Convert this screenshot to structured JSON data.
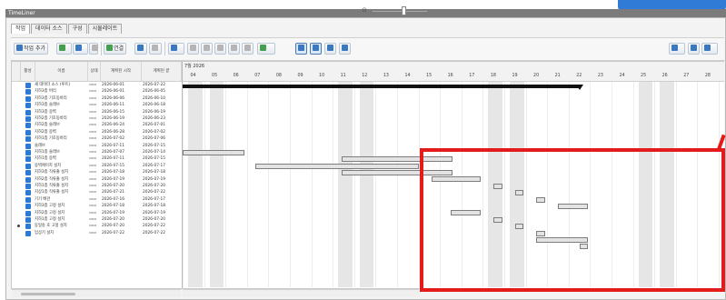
{
  "window": {
    "title": "TimeLiner"
  },
  "tabs": [
    "작업",
    "데이터 소스",
    "구성",
    "시뮬레이트"
  ],
  "toolbar": {
    "add_task": "작업 추가",
    "attach": "연결"
  },
  "columns": [
    "활성",
    "이름",
    "상태",
    "계획된 시작",
    "계획된 끝"
  ],
  "tasks": [
    {
      "name": "새 데이터 소스 (루트)",
      "status": "▭▭",
      "start": "2026-06-01",
      "end": "2026-07-22"
    },
    {
      "name": "지하3층 버리",
      "status": "▭▭",
      "start": "2026-06-01",
      "end": "2026-06-05"
    },
    {
      "name": "지하3층 기초동바리",
      "status": "▭▭",
      "start": "2026-06-06",
      "end": "2026-06-10"
    },
    {
      "name": "지하3층 슬래브",
      "status": "▭▭",
      "start": "2026-06-11",
      "end": "2026-06-18"
    },
    {
      "name": "지하3층 옹벽",
      "status": "▭▭",
      "start": "2026-06-15",
      "end": "2026-06-19"
    },
    {
      "name": "지하2층 기초동바리",
      "status": "▭▭",
      "start": "2026-06-19",
      "end": "2026-06-23"
    },
    {
      "name": "지하2층 슬래브",
      "status": "▭▭",
      "start": "2026-06-24",
      "end": "2026-07-01"
    },
    {
      "name": "지하2층 옹벽",
      "status": "▭▭",
      "start": "2026-06-28",
      "end": "2026-07-02"
    },
    {
      "name": "지하1층 기초동바리",
      "status": "▭▭",
      "start": "2026-07-02",
      "end": "2026-07-06"
    },
    {
      "name": "슬래브",
      "status": "▭▭",
      "start": "2026-07-11",
      "end": "2026-07-15"
    },
    {
      "name": "지하1층 슬래브",
      "status": "▭▭",
      "start": "2026-07-07",
      "end": "2026-07-14"
    },
    {
      "name": "지하1층 옹벽",
      "status": "▭▭",
      "start": "2026-07-11",
      "end": "2026-07-15"
    },
    {
      "name": "옹벽에이치 설치",
      "status": "▭▭",
      "start": "2026-07-15",
      "end": "2026-07-17"
    },
    {
      "name": "지하3층 직류출 설치",
      "status": "▭▭",
      "start": "2026-07-18",
      "end": "2026-07-18"
    },
    {
      "name": "지하2층 직류출 설치",
      "status": "▭▭",
      "start": "2026-07-19",
      "end": "2026-07-19"
    },
    {
      "name": "지하1층 직류출 설치",
      "status": "▭▭",
      "start": "2026-07-20",
      "end": "2026-07-20"
    },
    {
      "name": "지상1층 직류출 설치",
      "status": "▭▭",
      "start": "2026-07-21",
      "end": "2026-07-22"
    },
    {
      "name": "기기 배관",
      "status": "▭▭",
      "start": "2026-07-16",
      "end": "2026-07-17"
    },
    {
      "name": "지하3층 고정 설치",
      "status": "▭▭",
      "start": "2026-07-18",
      "end": "2026-07-18"
    },
    {
      "name": "지하2층 고정 설치",
      "status": "▭▭",
      "start": "2026-07-19",
      "end": "2026-07-19"
    },
    {
      "name": "지하1층 고정 설치",
      "status": "▭▭",
      "start": "2026-07-20",
      "end": "2026-07-20"
    },
    {
      "name": "동일송 호 고정 설치",
      "status": "▭▭",
      "start": "2026-07-20",
      "end": "2026-07-22"
    },
    {
      "name": "입상기 설치",
      "status": "▭▭",
      "start": "2026-07-22",
      "end": "2026-07-22"
    }
  ],
  "timeline": {
    "month_label": "7월 2026",
    "days": [
      "04",
      "05",
      "06",
      "07",
      "08",
      "09",
      "10",
      "11",
      "12",
      "13",
      "14",
      "15",
      "16",
      "17",
      "18",
      "19",
      "20",
      "21",
      "22",
      "23",
      "24",
      "25",
      "26",
      "27",
      "28"
    ],
    "bars": [
      {
        "row": 10,
        "start_day": 0.0,
        "end_day": 2.9
      },
      {
        "row": 11,
        "start_day": 7.4,
        "end_day": 12.6
      },
      {
        "row": 12,
        "start_day": 3.4,
        "end_day": 11.0
      },
      {
        "row": 13,
        "start_day": 7.4,
        "end_day": 12.6
      },
      {
        "row": 14,
        "start_day": 11.6,
        "end_day": 13.9
      },
      {
        "row": 15,
        "start_day": 14.5,
        "end_day": 14.9
      },
      {
        "row": 16,
        "start_day": 15.5,
        "end_day": 15.9
      },
      {
        "row": 17,
        "start_day": 16.5,
        "end_day": 16.9
      },
      {
        "row": 18,
        "start_day": 17.5,
        "end_day": 18.9
      },
      {
        "row": 19,
        "start_day": 12.5,
        "end_day": 13.9
      },
      {
        "row": 20,
        "start_day": 14.5,
        "end_day": 14.9
      },
      {
        "row": 21,
        "start_day": 15.5,
        "end_day": 15.9
      },
      {
        "row": 22,
        "start_day": 16.5,
        "end_day": 16.9
      },
      {
        "row": 23,
        "start_day": 16.5,
        "end_day": 18.9
      },
      {
        "row": 24,
        "start_day": 18.5,
        "end_day": 18.9
      }
    ],
    "summary_end_day": 18.5
  }
}
